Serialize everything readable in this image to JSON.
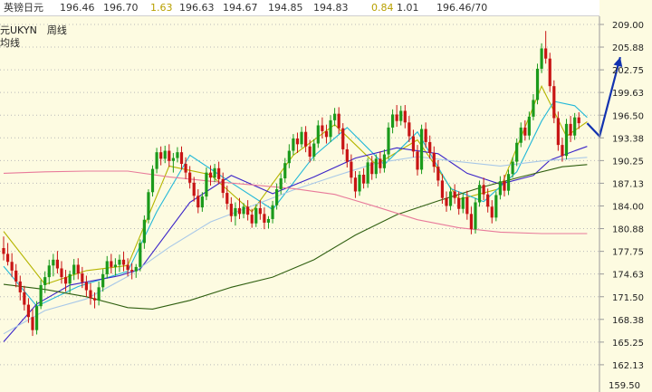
{
  "quote_bar": {
    "name": "英镑日元",
    "v1": "196.46",
    "v2": "196.70",
    "change": "1.63",
    "v3": "196.63",
    "v4": "194.67",
    "v5": "194.85",
    "v6": "194.83",
    "v7": "0.84",
    "v8": "1.01",
    "v9": "196.46/70",
    "change_color": "#b8a000",
    "v7_color": "#b8a000"
  },
  "chart_labels": {
    "symbol": "元UKYN　周线",
    "period": "均线"
  },
  "colors": {
    "background": "#fdfbe1",
    "grid": "#b9b9b9",
    "bull": "#1b9a1b",
    "bear": "#c81414",
    "ma_fast": "#b5b500",
    "ma_cyan": "#22b8d8",
    "ma_blue": "#3a23c8",
    "ma_lightblue": "#a8c8e8",
    "ma_green": "#2f5f10",
    "ma_pink": "#e87a9a",
    "arrow": "#1232b0"
  },
  "chart_data": {
    "type": "candlestick",
    "title": "",
    "ylim": [
      159.5,
      209.6
    ],
    "y_ticks": [
      "209.00",
      "205.88",
      "202.75",
      "199.63",
      "196.50",
      "193.38",
      "190.25",
      "187.13",
      "184.00",
      "180.88",
      "177.75",
      "174.63",
      "171.50",
      "168.38",
      "165.25",
      "162.13",
      "159.50"
    ],
    "grid": true,
    "candles": [
      [
        178.2,
        179.8,
        176.5,
        177.4
      ],
      [
        177.4,
        178.9,
        175.8,
        176.3
      ],
      [
        176.3,
        177.5,
        174.2,
        175.1
      ],
      [
        175.1,
        176.0,
        172.8,
        173.6
      ],
      [
        173.6,
        174.4,
        171.0,
        172.1
      ],
      [
        172.1,
        173.0,
        169.6,
        170.4
      ],
      [
        170.4,
        171.3,
        167.9,
        168.7
      ],
      [
        168.7,
        169.8,
        166.1,
        166.9
      ],
      [
        166.9,
        170.9,
        166.3,
        170.2
      ],
      [
        170.2,
        173.8,
        169.8,
        173.1
      ],
      [
        173.1,
        175.0,
        172.0,
        174.2
      ],
      [
        174.2,
        176.6,
        173.2,
        175.8
      ],
      [
        175.8,
        177.4,
        174.3,
        176.6
      ],
      [
        176.6,
        177.8,
        174.7,
        175.4
      ],
      [
        175.4,
        176.4,
        173.3,
        174.2
      ],
      [
        174.2,
        175.2,
        172.2,
        173.3
      ],
      [
        173.3,
        175.1,
        172.0,
        174.6
      ],
      [
        174.6,
        176.7,
        173.8,
        175.9
      ],
      [
        175.9,
        176.8,
        173.9,
        174.7
      ],
      [
        174.7,
        175.6,
        172.7,
        173.5
      ],
      [
        173.5,
        174.4,
        171.5,
        172.4
      ],
      [
        172.4,
        173.4,
        170.4,
        171.3
      ],
      [
        171.3,
        172.1,
        169.9,
        171.0
      ],
      [
        171.0,
        173.6,
        170.3,
        172.8
      ],
      [
        172.8,
        175.3,
        172.2,
        174.6
      ],
      [
        174.6,
        177.1,
        174.0,
        176.4
      ],
      [
        176.4,
        177.4,
        174.7,
        175.6
      ],
      [
        175.6,
        176.8,
        174.4,
        175.9
      ],
      [
        175.9,
        177.3,
        174.9,
        176.6
      ],
      [
        176.6,
        177.7,
        175.0,
        175.9
      ],
      [
        175.9,
        176.8,
        174.3,
        175.2
      ],
      [
        175.2,
        176.1,
        173.9,
        175.0
      ],
      [
        175.0,
        176.0,
        174.1,
        175.6
      ],
      [
        175.6,
        179.4,
        175.0,
        178.9
      ],
      [
        178.9,
        182.7,
        178.1,
        182.1
      ],
      [
        182.1,
        186.3,
        181.6,
        185.9
      ],
      [
        185.9,
        189.6,
        185.3,
        189.1
      ],
      [
        189.1,
        192.0,
        188.5,
        191.4
      ],
      [
        191.4,
        192.2,
        189.6,
        190.5
      ],
      [
        190.5,
        192.3,
        189.9,
        191.6
      ],
      [
        191.6,
        192.5,
        189.4,
        190.2
      ],
      [
        190.2,
        191.3,
        188.6,
        190.6
      ],
      [
        190.6,
        192.1,
        190.0,
        191.4
      ],
      [
        191.4,
        192.2,
        189.0,
        189.8
      ],
      [
        189.8,
        190.7,
        187.7,
        188.6
      ],
      [
        188.6,
        189.5,
        186.4,
        187.2
      ],
      [
        187.2,
        188.0,
        184.6,
        185.4
      ],
      [
        185.4,
        186.3,
        183.0,
        183.8
      ],
      [
        183.8,
        185.9,
        183.2,
        185.3
      ],
      [
        185.3,
        189.3,
        184.8,
        188.6
      ],
      [
        188.6,
        189.6,
        186.8,
        187.9
      ],
      [
        187.9,
        189.8,
        187.3,
        189.2
      ],
      [
        189.2,
        190.1,
        187.0,
        187.7
      ],
      [
        187.7,
        188.6,
        185.1,
        185.8
      ],
      [
        185.8,
        186.8,
        183.5,
        184.3
      ],
      [
        184.3,
        185.2,
        181.8,
        182.6
      ],
      [
        182.6,
        184.5,
        181.3,
        183.7
      ],
      [
        183.7,
        185.1,
        182.2,
        182.9
      ],
      [
        182.9,
        184.4,
        182.3,
        183.9
      ],
      [
        183.9,
        184.8,
        182.0,
        182.8
      ],
      [
        182.8,
        183.6,
        181.0,
        181.6
      ],
      [
        181.6,
        184.2,
        181.1,
        183.7
      ],
      [
        183.7,
        184.8,
        182.1,
        182.9
      ],
      [
        182.9,
        183.8,
        180.8,
        181.7
      ],
      [
        181.7,
        182.6,
        180.9,
        182.2
      ],
      [
        182.2,
        184.7,
        181.6,
        184.1
      ],
      [
        184.1,
        187.1,
        183.5,
        186.3
      ],
      [
        186.3,
        188.5,
        185.6,
        187.8
      ],
      [
        187.8,
        190.6,
        187.2,
        189.9
      ],
      [
        189.9,
        192.5,
        189.2,
        191.6
      ],
      [
        191.6,
        193.9,
        191.0,
        193.3
      ],
      [
        193.3,
        194.1,
        191.3,
        192.5
      ],
      [
        192.5,
        194.9,
        192.0,
        194.2
      ],
      [
        194.2,
        195.0,
        191.4,
        192.2
      ],
      [
        192.2,
        193.1,
        190.0,
        190.8
      ],
      [
        190.8,
        193.2,
        190.2,
        192.6
      ],
      [
        192.6,
        195.8,
        192.0,
        195.1
      ],
      [
        195.1,
        196.2,
        193.3,
        194.3
      ],
      [
        194.3,
        195.2,
        192.6,
        193.5
      ],
      [
        193.5,
        196.5,
        192.8,
        195.8
      ],
      [
        195.8,
        197.5,
        195.0,
        196.7
      ],
      [
        196.7,
        197.6,
        193.9,
        194.7
      ],
      [
        194.7,
        195.4,
        191.1,
        191.8
      ],
      [
        191.8,
        192.6,
        189.3,
        190.1
      ],
      [
        190.1,
        191.1,
        187.1,
        187.9
      ],
      [
        187.9,
        188.8,
        185.1,
        186.0
      ],
      [
        186.0,
        188.8,
        185.4,
        188.3
      ],
      [
        188.3,
        189.2,
        186.4,
        187.1
      ],
      [
        187.1,
        190.6,
        186.5,
        190.0
      ],
      [
        190.0,
        190.9,
        187.6,
        188.4
      ],
      [
        188.4,
        191.1,
        187.8,
        190.5
      ],
      [
        190.5,
        191.5,
        188.5,
        189.2
      ],
      [
        189.2,
        191.8,
        188.6,
        191.1
      ],
      [
        191.1,
        195.5,
        190.4,
        194.8
      ],
      [
        194.8,
        197.3,
        194.0,
        196.6
      ],
      [
        196.6,
        197.9,
        194.9,
        195.7
      ],
      [
        195.7,
        197.8,
        195.1,
        197.1
      ],
      [
        197.1,
        197.9,
        194.7,
        195.5
      ],
      [
        195.5,
        196.4,
        192.8,
        193.6
      ],
      [
        193.6,
        194.5,
        190.7,
        191.5
      ],
      [
        191.5,
        192.4,
        188.2,
        189.0
      ],
      [
        189.0,
        195.2,
        188.4,
        194.6
      ],
      [
        194.6,
        195.5,
        192.0,
        192.8
      ],
      [
        192.8,
        193.7,
        190.5,
        191.3
      ],
      [
        191.3,
        192.2,
        188.6,
        189.4
      ],
      [
        189.4,
        190.3,
        186.7,
        187.5
      ],
      [
        187.5,
        188.4,
        184.3,
        185.1
      ],
      [
        185.1,
        186.0,
        183.2,
        184.0
      ],
      [
        184.0,
        186.6,
        183.4,
        186.0
      ],
      [
        186.0,
        187.0,
        184.3,
        185.1
      ],
      [
        185.1,
        186.0,
        182.8,
        183.6
      ],
      [
        183.6,
        185.8,
        183.0,
        185.2
      ],
      [
        185.2,
        186.1,
        182.1,
        182.9
      ],
      [
        182.9,
        183.9,
        180.1,
        180.8
      ],
      [
        180.8,
        185.1,
        180.2,
        184.5
      ],
      [
        184.5,
        187.5,
        183.9,
        186.9
      ],
      [
        186.9,
        187.9,
        184.8,
        185.6
      ],
      [
        185.6,
        186.4,
        183.1,
        183.9
      ],
      [
        183.9,
        184.8,
        181.6,
        182.4
      ],
      [
        182.4,
        186.0,
        181.9,
        185.5
      ],
      [
        185.5,
        188.1,
        184.9,
        187.4
      ],
      [
        187.4,
        188.3,
        185.3,
        186.1
      ],
      [
        186.1,
        189.0,
        185.5,
        188.4
      ],
      [
        188.4,
        190.7,
        187.9,
        190.1
      ],
      [
        190.1,
        193.3,
        189.5,
        192.7
      ],
      [
        192.7,
        195.5,
        192.1,
        194.8
      ],
      [
        194.8,
        195.8,
        193.0,
        193.7
      ],
      [
        193.7,
        197.0,
        193.1,
        196.3
      ],
      [
        196.3,
        199.4,
        195.8,
        198.6
      ],
      [
        198.6,
        203.6,
        198.0,
        202.9
      ],
      [
        202.9,
        206.4,
        202.3,
        205.7
      ],
      [
        205.7,
        208.1,
        203.6,
        204.3
      ],
      [
        204.3,
        205.1,
        199.7,
        200.5
      ],
      [
        200.5,
        201.3,
        195.4,
        196.1
      ],
      [
        196.1,
        197.0,
        191.6,
        192.4
      ],
      [
        192.4,
        193.4,
        190.1,
        190.9
      ],
      [
        190.9,
        196.0,
        190.4,
        195.3
      ],
      [
        195.3,
        196.4,
        192.8,
        193.7
      ],
      [
        193.7,
        196.8,
        193.1,
        196.2
      ],
      [
        196.2,
        196.9,
        194.6,
        195.4
      ]
    ],
    "series": [
      {
        "name": "",
        "type": "ma",
        "values": [
          [
            0,
            180.5
          ],
          [
            10,
            173.2
          ],
          [
            20,
            175.1
          ],
          [
            30,
            175.8
          ],
          [
            40,
            189.5
          ],
          [
            50,
            188.3
          ],
          [
            60,
            183.2
          ],
          [
            70,
            191.0
          ],
          [
            80,
            195.2
          ],
          [
            90,
            189.7
          ],
          [
            100,
            193.1
          ],
          [
            110,
            184.9
          ],
          [
            120,
            186.4
          ],
          [
            130,
            200.5
          ],
          [
            136,
            193.6
          ],
          [
            141,
            195.6
          ]
        ]
      },
      {
        "name": "",
        "type": "ma",
        "values": [
          [
            0,
            175.7
          ],
          [
            8,
            170.2
          ],
          [
            18,
            172.9
          ],
          [
            30,
            175.0
          ],
          [
            37,
            183.2
          ],
          [
            45,
            191.0
          ],
          [
            55,
            187.2
          ],
          [
            65,
            183.5
          ],
          [
            75,
            190.9
          ],
          [
            83,
            194.8
          ],
          [
            92,
            189.7
          ],
          [
            100,
            194.2
          ],
          [
            108,
            186.4
          ],
          [
            116,
            184.6
          ],
          [
            124,
            188.7
          ],
          [
            130,
            195.7
          ],
          [
            133,
            198.4
          ],
          [
            138,
            197.8
          ],
          [
            141,
            196.2
          ]
        ]
      },
      {
        "name": "",
        "type": "ma",
        "values": [
          [
            0,
            165.3
          ],
          [
            8,
            170.5
          ],
          [
            16,
            173.1
          ],
          [
            28,
            174.4
          ],
          [
            33,
            175.3
          ],
          [
            45,
            184.5
          ],
          [
            55,
            188.2
          ],
          [
            65,
            185.7
          ],
          [
            75,
            188.0
          ],
          [
            85,
            190.6
          ],
          [
            95,
            192.0
          ],
          [
            105,
            191.2
          ],
          [
            112,
            188.5
          ],
          [
            120,
            187.0
          ],
          [
            128,
            188.2
          ],
          [
            132,
            190.3
          ],
          [
            138,
            191.6
          ],
          [
            141,
            192.2
          ]
        ]
      },
      {
        "name": "",
        "type": "ma",
        "values": [
          [
            0,
            166.4
          ],
          [
            10,
            169.6
          ],
          [
            20,
            171.2
          ],
          [
            30,
            174.3
          ],
          [
            40,
            178.3
          ],
          [
            50,
            181.8
          ],
          [
            60,
            184.0
          ],
          [
            70,
            186.2
          ],
          [
            80,
            188.1
          ],
          [
            90,
            189.9
          ],
          [
            100,
            190.8
          ],
          [
            110,
            190.1
          ],
          [
            120,
            189.5
          ],
          [
            130,
            190.2
          ],
          [
            141,
            190.7
          ]
        ]
      },
      {
        "name": "",
        "type": "ma",
        "values": [
          [
            0,
            173.2
          ],
          [
            10,
            172.5
          ],
          [
            20,
            171.5
          ],
          [
            30,
            170.0
          ],
          [
            36,
            169.8
          ],
          [
            45,
            171.0
          ],
          [
            55,
            172.8
          ],
          [
            65,
            174.2
          ],
          [
            75,
            176.6
          ],
          [
            85,
            180.0
          ],
          [
            95,
            182.8
          ],
          [
            105,
            184.7
          ],
          [
            115,
            186.5
          ],
          [
            125,
            188.0
          ],
          [
            135,
            189.4
          ],
          [
            141,
            189.7
          ]
        ]
      },
      {
        "name": "",
        "type": "ma",
        "values": [
          [
            0,
            188.5
          ],
          [
            10,
            188.7
          ],
          [
            20,
            188.8
          ],
          [
            30,
            188.8
          ],
          [
            40,
            188.0
          ],
          [
            50,
            187.4
          ],
          [
            60,
            186.9
          ],
          [
            70,
            186.4
          ],
          [
            80,
            185.6
          ],
          [
            90,
            183.9
          ],
          [
            100,
            182.1
          ],
          [
            110,
            181.0
          ],
          [
            120,
            180.4
          ],
          [
            130,
            180.2
          ],
          [
            141,
            180.2
          ]
        ]
      }
    ],
    "annotation_arrow": [
      [
        141,
        195.4
      ],
      [
        144,
        193.6
      ],
      [
        149,
        204.5
      ]
    ]
  }
}
